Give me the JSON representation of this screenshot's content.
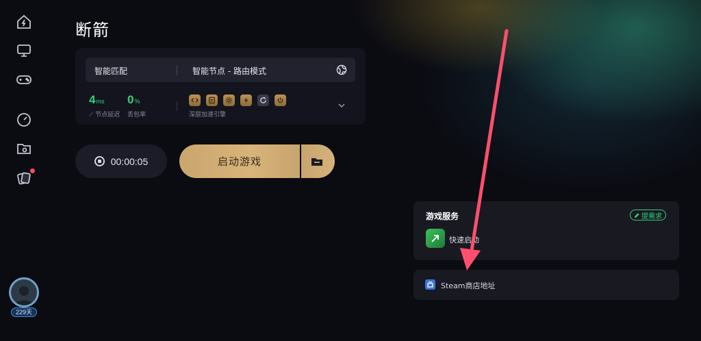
{
  "header": {
    "title": "断箭"
  },
  "sidebar": {
    "items": [
      {
        "icon": "home-lightning-icon"
      },
      {
        "icon": "monitor-icon"
      },
      {
        "icon": "gamepad-icon"
      },
      {
        "icon": "speedometer-icon"
      },
      {
        "icon": "folder-icon"
      },
      {
        "icon": "cards-icon",
        "has_notification": true
      }
    ],
    "user": {
      "days_badge": "229天"
    }
  },
  "panel": {
    "mode_left": "智能匹配",
    "mode_right": "智能节点 - 路由模式",
    "latency": {
      "value": "4",
      "unit": "ms",
      "label": "节点延迟"
    },
    "loss": {
      "value": "0",
      "unit": "%",
      "label": "丢包率"
    },
    "engine_label": "深层加速引擎"
  },
  "controls": {
    "timer": "00:00:05",
    "launch_label": "启动游戏"
  },
  "service": {
    "title": "游戏服务",
    "request_button": "提需求",
    "quick_launch": "快速启动",
    "steam_store": "Steam商店地址"
  },
  "colors": {
    "accent_green": "#2fd37a",
    "launch_gold": "#d8b47a",
    "annotation_arrow": "#ff4f6d"
  }
}
